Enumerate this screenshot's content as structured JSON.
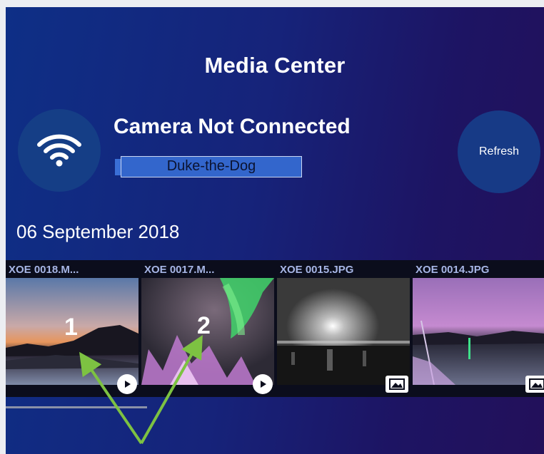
{
  "header": {
    "title": "Media Center"
  },
  "connection": {
    "status_title": "Camera Not Connected",
    "camera_name": "Duke-the-Dog",
    "refresh_label": "Refresh",
    "icon": "wifi-icon"
  },
  "gallery": {
    "date": "06 September 2018",
    "items": [
      {
        "label": "XOE 0018.M...",
        "type": "video",
        "badge_icon": "play-icon"
      },
      {
        "label": "XOE 0017.M...",
        "type": "video",
        "badge_icon": "play-icon"
      },
      {
        "label": "XOE 0015.JPG",
        "type": "photo",
        "badge_icon": "image-icon"
      },
      {
        "label": "XOE 0014.JPG",
        "type": "photo",
        "badge_icon": "image-icon"
      }
    ]
  },
  "annotations": {
    "marker_1": "1",
    "marker_2": "2",
    "arrow_color": "#7dc242"
  },
  "colors": {
    "accent": "#153e86",
    "name_box": "#3366cc"
  }
}
